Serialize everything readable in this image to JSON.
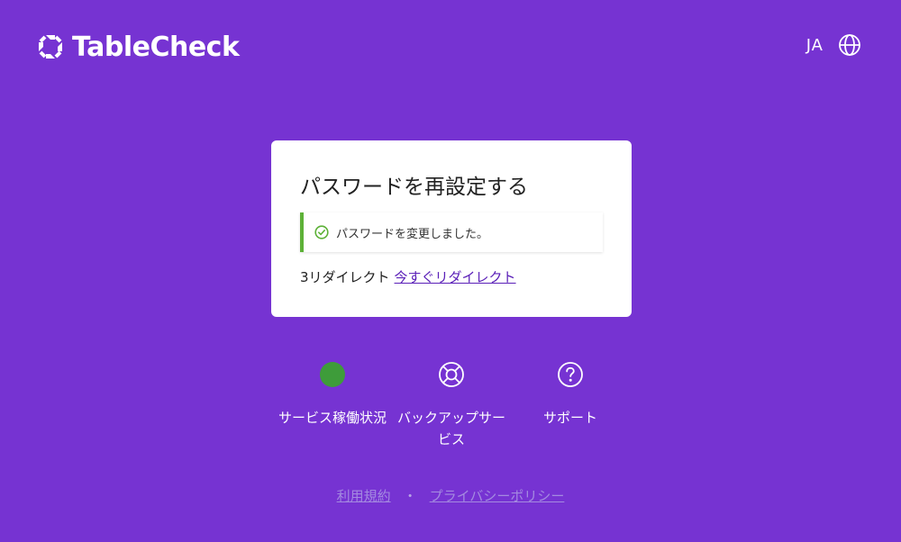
{
  "header": {
    "brand": "TableCheck",
    "language_code": "JA",
    "logo_icon": "tablecheck-logo-icon",
    "language_icon": "globe-icon"
  },
  "card": {
    "title": "パスワードを再設定する",
    "alert": {
      "message": "パスワードを変更しました。",
      "icon": "check-circle-icon",
      "accent_color": "#5DB137"
    },
    "redirect": {
      "countdown_text": "3リダイレクト",
      "link_label": "今すぐリダイレクト"
    }
  },
  "services": [
    {
      "label": "サービス稼働状況",
      "icon": "status-dot",
      "status_color": "#3E9C3A"
    },
    {
      "label": "バックアップサービス",
      "icon": "lifebuoy-icon"
    },
    {
      "label": "サポート",
      "icon": "question-circle-icon"
    }
  ],
  "footer": {
    "terms_label": "利用規約",
    "separator": "・",
    "privacy_label": "プライバシーポリシー"
  },
  "colors": {
    "background": "#7633D2",
    "card": "#FFFFFF",
    "link": "#5B20B8"
  }
}
